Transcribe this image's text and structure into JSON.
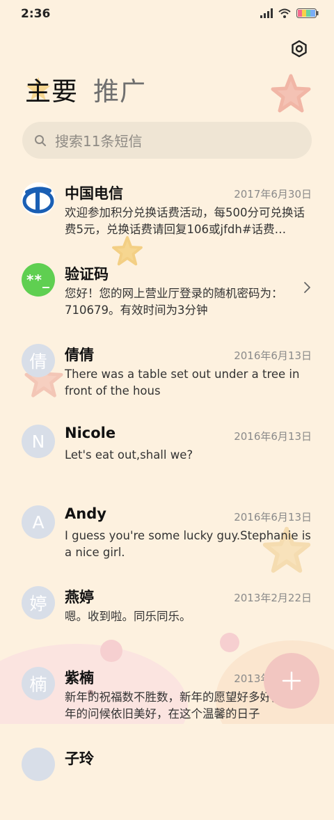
{
  "status_bar": {
    "time": "2:36"
  },
  "header": {
    "settings_icon": "gear-hexagon-icon"
  },
  "tabs": [
    {
      "label": "主要",
      "active": true
    },
    {
      "label": "推广",
      "active": false
    }
  ],
  "search": {
    "placeholder": "搜索11条短信"
  },
  "messages": [
    {
      "name": "中国电信",
      "date": "2017年6月30日",
      "preview": "欢迎参加积分兑换话费活动，每500分可兑换话费5元，兑换话费请回复106或jfdh#话费…",
      "avatar": "telecom-logo"
    },
    {
      "name": "验证码",
      "date": "",
      "preview": "您好！您的网上营业厅登录的随机密码为：710679。有效时间为3分钟",
      "avatar_text": "**_"
    },
    {
      "name": "倩倩",
      "date": "2016年6月13日",
      "preview": "There was a table set out under a tree in front of the hous",
      "avatar_text": "倩"
    },
    {
      "name": "Nicole",
      "date": "2016年6月13日",
      "preview": "Let's eat out,shall we?",
      "avatar_text": "N"
    },
    {
      "name": "Andy",
      "date": "2016年6月13日",
      "preview": "I guess you're some lucky guy.Stephanie is a nice girl.",
      "avatar_text": "A"
    },
    {
      "name": "燕婷",
      "date": "2013年2月22日",
      "preview": "嗯。收到啦。同乐同乐。",
      "avatar_text": "婷"
    },
    {
      "name": "紫楠",
      "date": "2013年2月22日",
      "preview": "新年的祝福数不胜数，新年的愿望好多好多，新年的问候依旧美好，在这个温馨的日子",
      "avatar_text": "楠"
    },
    {
      "name": "子玲",
      "date": "",
      "preview": "",
      "avatar_text": ""
    }
  ],
  "fab": {
    "icon": "plus-icon"
  },
  "colors": {
    "background": "#fdf1df",
    "accent_green": "#5fcf51",
    "fab": "#f2c6c1"
  }
}
